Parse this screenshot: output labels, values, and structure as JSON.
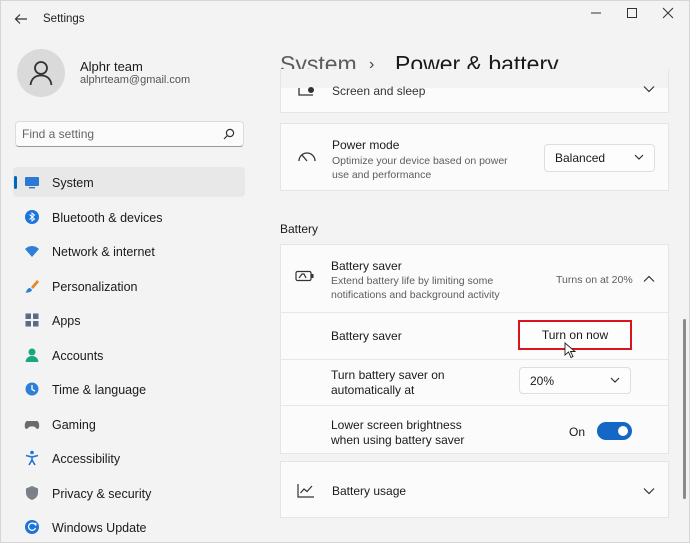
{
  "window": {
    "title": "Settings"
  },
  "account": {
    "name": "Alphr team",
    "email": "alphrteam@gmail.com"
  },
  "search": {
    "placeholder": "Find a setting"
  },
  "nav": {
    "items": [
      {
        "label": "System",
        "icon": "monitor-icon",
        "active": true
      },
      {
        "label": "Bluetooth & devices",
        "icon": "bluetooth-icon"
      },
      {
        "label": "Network & internet",
        "icon": "wifi-icon"
      },
      {
        "label": "Personalization",
        "icon": "brush-icon"
      },
      {
        "label": "Apps",
        "icon": "apps-grid-icon"
      },
      {
        "label": "Accounts",
        "icon": "person-icon"
      },
      {
        "label": "Time & language",
        "icon": "globe-clock-icon"
      },
      {
        "label": "Gaming",
        "icon": "controller-icon"
      },
      {
        "label": "Accessibility",
        "icon": "accessibility-icon"
      },
      {
        "label": "Privacy & security",
        "icon": "shield-icon"
      },
      {
        "label": "Windows Update",
        "icon": "update-icon"
      }
    ]
  },
  "header": {
    "root": "System",
    "separator": "›",
    "page": "Power & battery"
  },
  "content": {
    "screen_sleep": {
      "title": "Screen and sleep"
    },
    "power_mode": {
      "title": "Power mode",
      "desc_line1": "Optimize your device based on power",
      "desc_line2": "use and performance",
      "value": "Balanced"
    },
    "battery_section": "Battery",
    "battery_saver": {
      "title": "Battery saver",
      "desc_line1": "Extend battery life by limiting some",
      "desc_line2": "notifications and background activity",
      "status": "Turns on at 20%"
    },
    "battery_saver_row": {
      "label": "Battery saver",
      "button": "Turn on now"
    },
    "auto_row": {
      "label_line1": "Turn battery saver on",
      "label_line2": "automatically at",
      "value": "20%"
    },
    "brightness_row": {
      "label_line1": "Lower screen brightness",
      "label_line2": "when using battery saver",
      "toggle_text": "On"
    },
    "battery_usage": {
      "title": "Battery usage"
    }
  },
  "colors": {
    "accent": "#0067c0",
    "toggle": "#1467c4",
    "highlight": "#d9141f"
  }
}
